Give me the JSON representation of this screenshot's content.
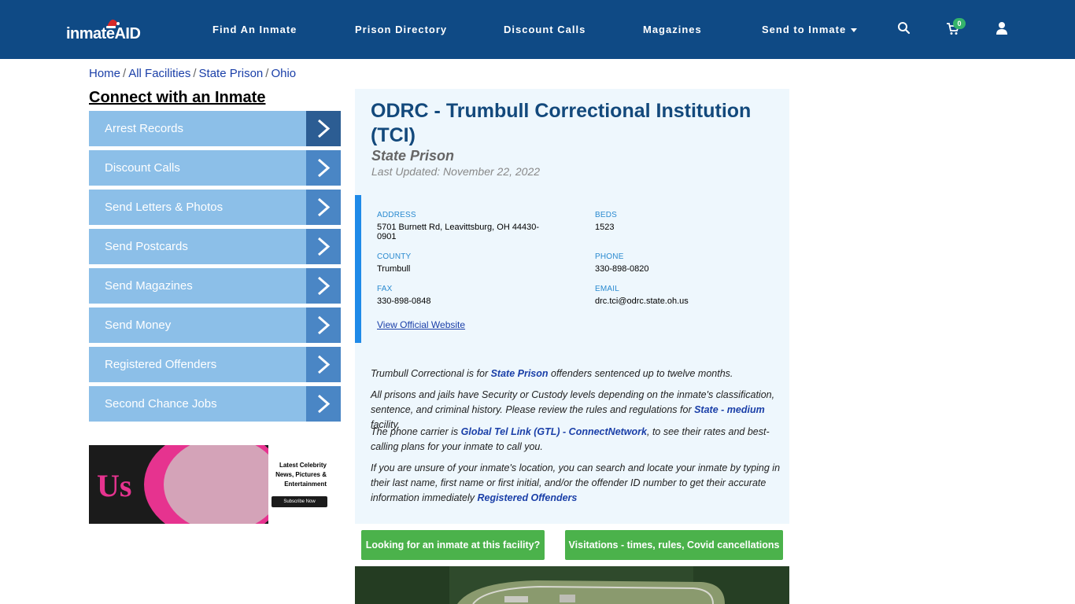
{
  "header": {
    "logo_text": "inmateAID",
    "nav": [
      {
        "label": "Find An Inmate"
      },
      {
        "label": "Prison Directory"
      },
      {
        "label": "Discount Calls"
      },
      {
        "label": "Magazines"
      },
      {
        "label": "Send to Inmate"
      }
    ],
    "cart_count": "0",
    "icons": [
      "search-icon",
      "cart-icon",
      "user-icon"
    ]
  },
  "breadcrumb": [
    "Home",
    "All Facilities",
    "State Prison",
    "Ohio"
  ],
  "sidebar": {
    "title": "Connect with an Inmate",
    "items": [
      {
        "label": "Arrest Records"
      },
      {
        "label": "Discount Calls"
      },
      {
        "label": "Send Letters & Photos"
      },
      {
        "label": "Send Postcards"
      },
      {
        "label": "Send Magazines"
      },
      {
        "label": "Send Money"
      },
      {
        "label": "Registered Offenders"
      },
      {
        "label": "Second Chance Jobs"
      }
    ]
  },
  "ad": {
    "logo": "Us",
    "text": "Latest Celebrity News, Pictures & Entertainment",
    "button": "Subscribe Now"
  },
  "facility": {
    "title": "ODRC - Trumbull Correctional Institution (TCI)",
    "type": "State Prison",
    "updated": "Last Updated: November 22, 2022",
    "address_label": "ADDRESS",
    "address": "5701 Burnett Rd, Leavittsburg, OH 44430-0901",
    "beds_label": "BEDS",
    "beds": "1523",
    "county_label": "COUNTY",
    "county": "Trumbull",
    "phone_label": "PHONE",
    "phone": "330-898-0820",
    "fax_label": "FAX",
    "fax": "330-898-0848",
    "email_label": "EMAIL",
    "email": "drc.tci@odrc.state.oh.us",
    "website_link": "View Official Website"
  },
  "paragraphs": {
    "p1_a": "Trumbull Correctional is for ",
    "p1_b": "State Prison",
    "p1_c": " offenders sentenced up to twelve months.",
    "p2_a": "All prisons and jails have Security or Custody levels depending on the inmate's classification, sentence, and criminal history. Please review the rules and regulations for ",
    "p2_b": "State - medium",
    "p2_c": " facility.",
    "p3_a": "The phone carrier is ",
    "p3_b": "Global Tel Link (GTL) - ConnectNetwork",
    "p3_c": ", to see their rates and best-calling plans for your inmate to call you.",
    "p4_a": "If you are unsure of your inmate's location, you can search and locate your inmate by typing in their last name, first name or first initial, and/or the offender ID number to get their accurate information immediately ",
    "p4_b": "Registered Offenders"
  },
  "buttons": {
    "looking": "Looking for an inmate at this facility?",
    "visitations": "Visitations - times, rules, Covid cancellations"
  },
  "colors": {
    "header_bg": "#0f4a85",
    "sidebar_item": "#8cbfe8",
    "sidebar_arrow": "#4a86c5",
    "title": "#13497c",
    "green_button": "#4bb24b",
    "panel_bg": "#eef7fd"
  }
}
